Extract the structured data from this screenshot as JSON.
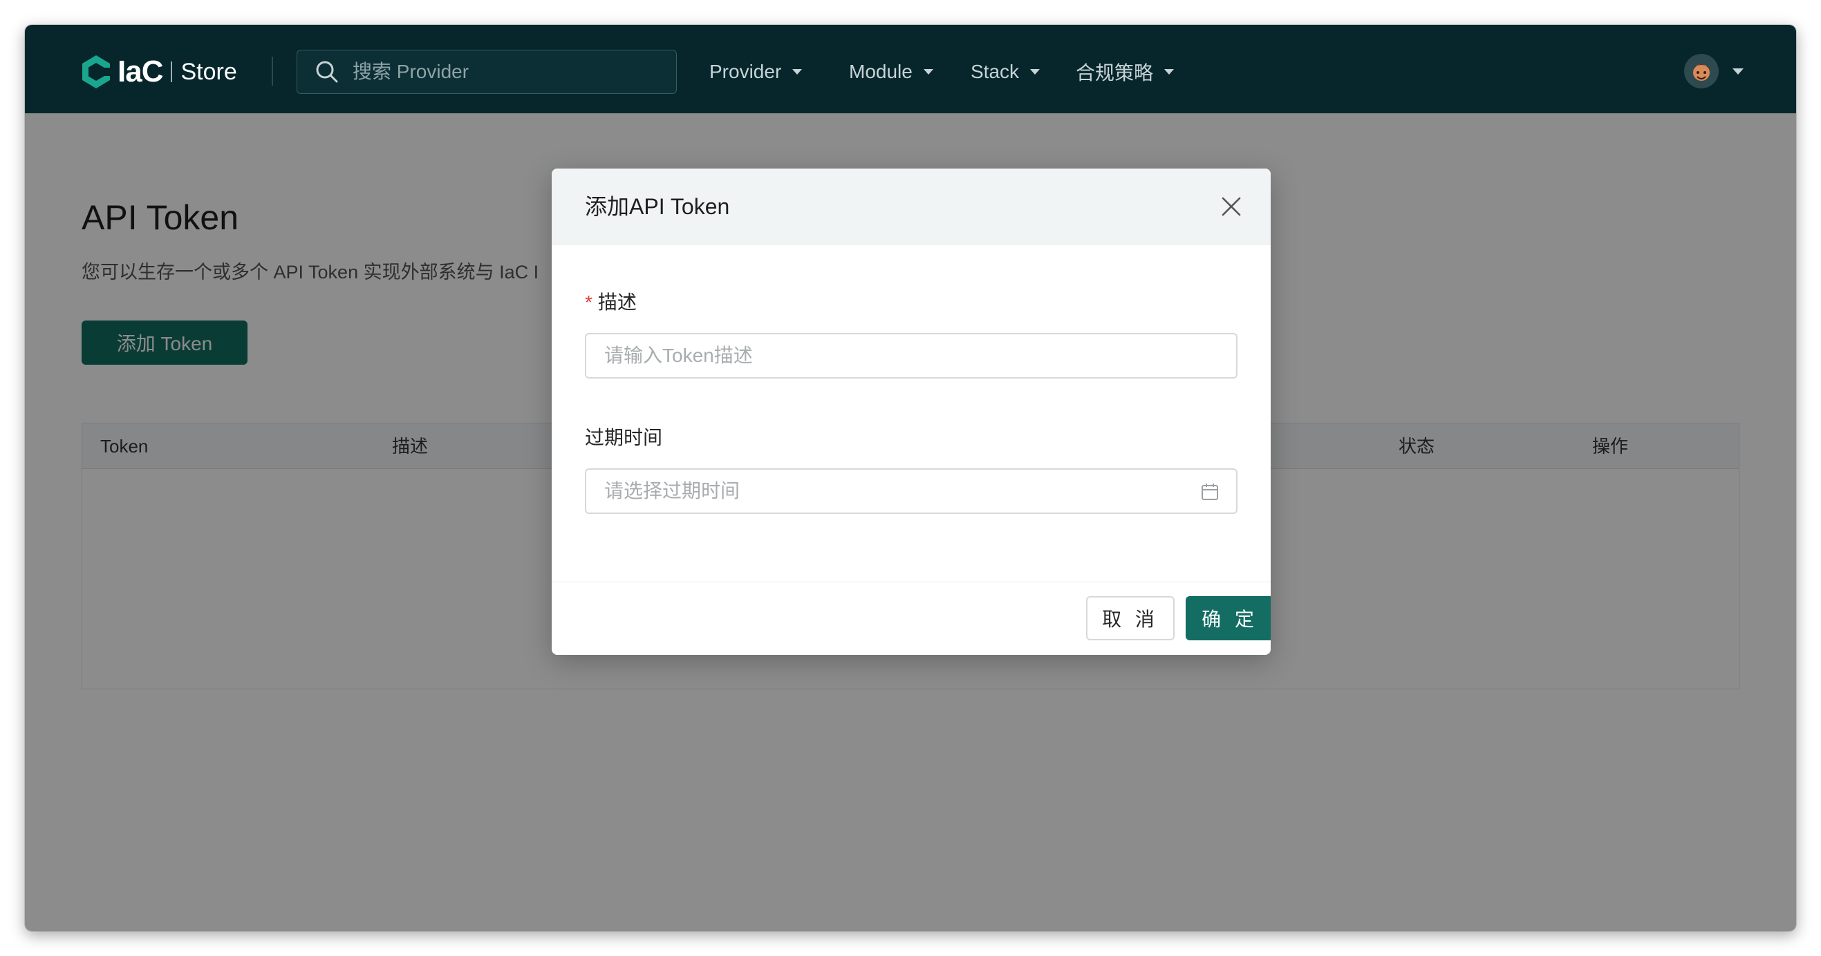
{
  "brand": {
    "name": "IaC",
    "suffix": "Store"
  },
  "search": {
    "placeholder": "搜索 Provider"
  },
  "nav": {
    "items": [
      {
        "label": "Provider"
      },
      {
        "label": "Module"
      },
      {
        "label": "Stack"
      },
      {
        "label": "合规策略"
      }
    ]
  },
  "page": {
    "title": "API Token",
    "description": "您可以生存一个或多个 API Token 实现外部系统与 IaC I",
    "add_button": "添加 Token"
  },
  "table": {
    "columns": [
      "Token",
      "描述",
      "状态",
      "操作"
    ]
  },
  "modal": {
    "title": "添加API Token",
    "desc_label": "描述",
    "required_mark": "*",
    "desc_placeholder": "请输入Token描述",
    "expire_label": "过期时间",
    "expire_placeholder": "请选择过期时间",
    "cancel_label": "取 消",
    "ok_label": "确 定"
  },
  "colors": {
    "nav_bg": "#06262c",
    "accent": "#136d63",
    "required": "#e5393a"
  }
}
